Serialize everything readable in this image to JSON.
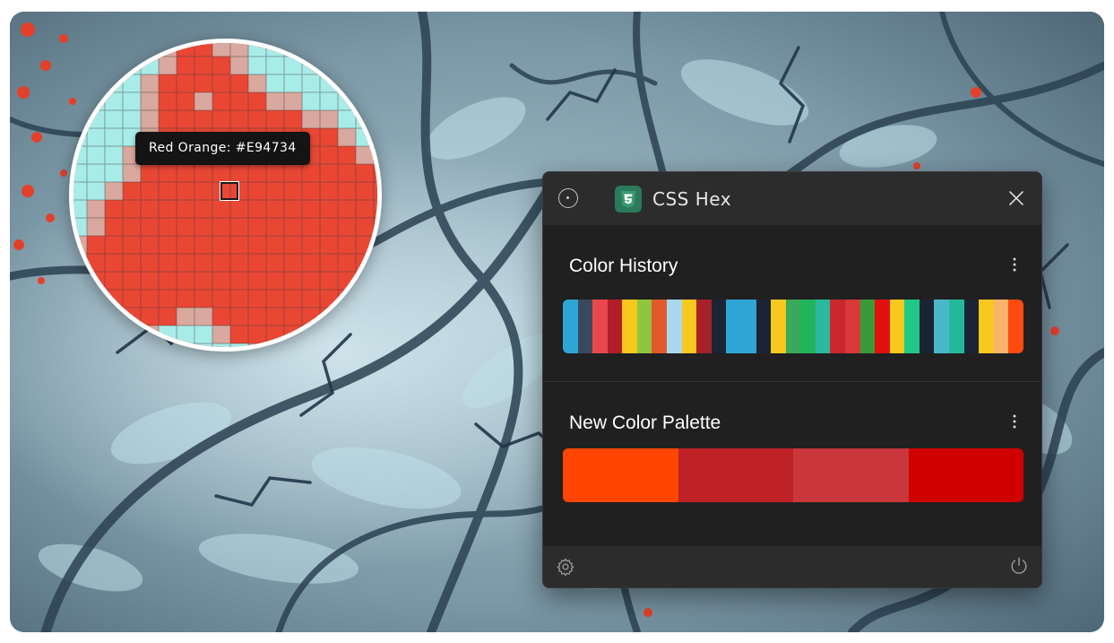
{
  "magnifier": {
    "tooltip": "Red Orange: #E94734",
    "picked_color": "#E94734",
    "pixels": [
      "lllllmrrmmlllllllm",
      "lllllmrrrmllllllll",
      "llllmrrrrrmlllllll",
      "llllmrrmrrrmmlllll",
      "llllmrrrrrrrrmmlll",
      "llllmrrrrrrrrrrmll",
      "lllmrrrrrrrrrrrrml",
      "lllmrrrrrrrrrrrrrr",
      "llmrrrrrrrrrrrrrrr",
      "lmrrrrrrrrrrrrrrrr",
      "lmrrrrrrrrrrrrrrrr",
      "mrrrrrrrrrrrrrrrrr",
      "mrrrrrrrrrrrrrrrrr",
      "rrrrrrrrrrrrrrrrrr",
      "rrrrrrrrrrrrrrrrrr",
      "rrrrrrmmrrrrrrrrrr",
      "rrrrmlllmrrrrrrrrr",
      "rrrmllllllmrrrrrrr"
    ],
    "pixel_colors": {
      "l": "#a8ece8",
      "m": "#d9a89e",
      "r": "#e94734"
    }
  },
  "app": {
    "title": "CSS Hex",
    "icon": "css3-icon",
    "accent": "#2b7a5c"
  },
  "history": {
    "title": "Color History",
    "swatches": [
      "#2fa5d6",
      "#3a4a5e",
      "#e8484c",
      "#b01e2a",
      "#f8c81e",
      "#8dc63f",
      "#e05a2b",
      "#a8d8ec",
      "#f8c81e",
      "#a8202a",
      "#1a2434",
      "#2fa5d6",
      "#2fa5d6",
      "#1a2434",
      "#f8c81e",
      "#3aaa5a",
      "#22b45a",
      "#2ab8a0",
      "#c8282e",
      "#d83a3a",
      "#3a9a3a",
      "#e01010",
      "#f8c81e",
      "#20c888",
      "#1a2434",
      "#4ab8c8",
      "#24b89a",
      "#1a2434",
      "#f8c81e",
      "#f8b468",
      "#ff4a10"
    ]
  },
  "palette": {
    "title": "New Color Palette",
    "swatches": [
      "#ff4500",
      "#be2126",
      "#c9373c",
      "#d10000"
    ]
  }
}
